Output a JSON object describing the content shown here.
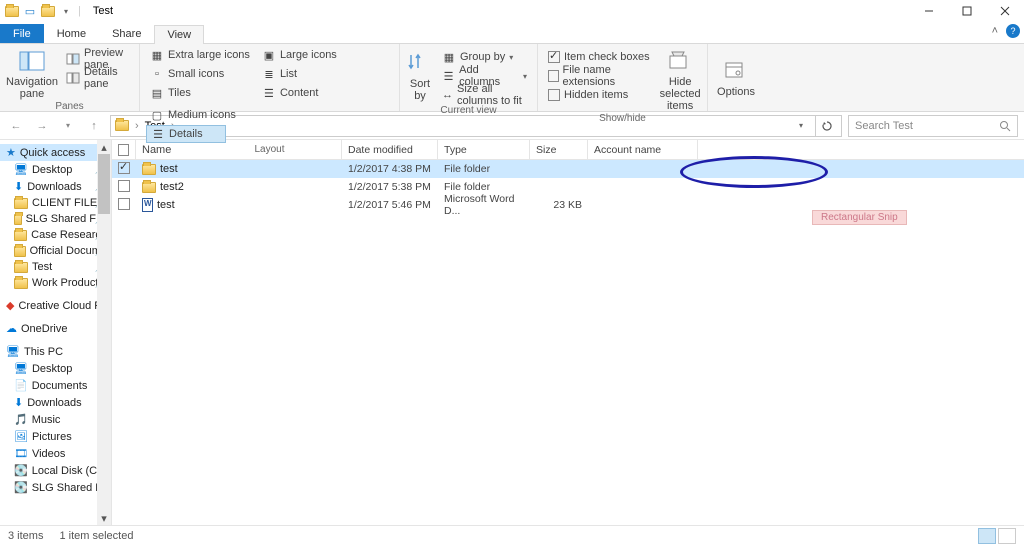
{
  "window": {
    "title": "Test"
  },
  "tabs": {
    "file": "File",
    "home": "Home",
    "share": "Share",
    "view": "View"
  },
  "ribbon": {
    "panes": {
      "label": "Panes",
      "navigation": "Navigation pane",
      "preview": "Preview pane",
      "details": "Details pane"
    },
    "layout": {
      "label": "Layout",
      "extralarge": "Extra large icons",
      "large": "Large icons",
      "medium": "Medium icons",
      "small": "Small icons",
      "list": "List",
      "details": "Details",
      "tiles": "Tiles",
      "content": "Content"
    },
    "currentview": {
      "label": "Current view",
      "sortby": "Sort by",
      "groupby": "Group by",
      "addcols": "Add columns",
      "sizecols": "Size all columns to fit"
    },
    "showhide": {
      "label": "Show/hide",
      "checkboxes": "Item check boxes",
      "extensions": "File name extensions",
      "hidden": "Hidden items",
      "hideselected": "Hide selected items"
    },
    "options": {
      "label": "Options"
    }
  },
  "breadcrumb": {
    "root": "Test"
  },
  "search": {
    "placeholder": "Search Test"
  },
  "columns": {
    "name": "Name",
    "modified": "Date modified",
    "type": "Type",
    "size": "Size",
    "account": "Account name"
  },
  "rows": [
    {
      "name": "test",
      "modified": "1/2/2017 4:38 PM",
      "type": "File folder",
      "size": "",
      "icon": "folder",
      "checked": true,
      "selected": true
    },
    {
      "name": "test2",
      "modified": "1/2/2017 5:38 PM",
      "type": "File folder",
      "size": "",
      "icon": "folder",
      "checked": false,
      "selected": false
    },
    {
      "name": "test",
      "modified": "1/2/2017 5:46 PM",
      "type": "Microsoft Word D...",
      "size": "23 KB",
      "icon": "doc",
      "checked": false,
      "selected": false
    }
  ],
  "nav": {
    "quickaccess": "Quick access",
    "items_qa": [
      "Desktop",
      "Downloads",
      "CLIENT FILES",
      "SLG Shared F…",
      "Case Research",
      "Official Docume",
      "Test",
      "Work Product"
    ],
    "cc": "Creative Cloud Fil",
    "onedrive": "OneDrive",
    "thispc": "This PC",
    "items_pc": [
      "Desktop",
      "Documents",
      "Downloads",
      "Music",
      "Pictures",
      "Videos",
      "Local Disk (C:)",
      "SLG Shared Fold"
    ]
  },
  "status": {
    "count": "3 items",
    "selected": "1 item selected"
  },
  "annotation": {
    "snip": "Rectangular Snip"
  }
}
